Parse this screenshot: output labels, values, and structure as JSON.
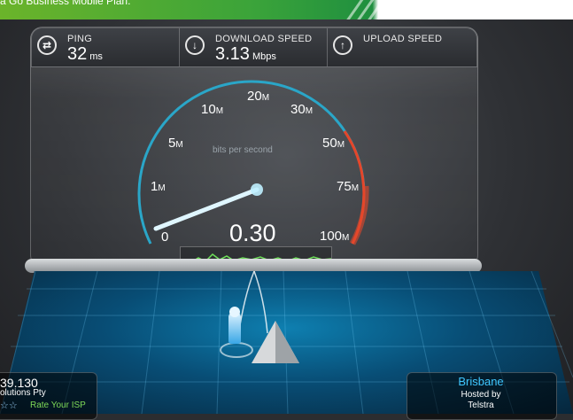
{
  "banner": {
    "text": "a Go Business Mobile Plan."
  },
  "stats": {
    "ping": {
      "label": "PING",
      "value": "32",
      "unit": "ms",
      "icon": "swap-arrows-icon"
    },
    "download": {
      "label": "DOWNLOAD SPEED",
      "value": "3.13",
      "unit": "Mbps",
      "icon": "down-arrow-icon"
    },
    "upload": {
      "label": "UPLOAD SPEED",
      "value": "",
      "unit": "",
      "icon": "up-arrow-icon"
    }
  },
  "gauge": {
    "unit_text": "bits per second",
    "reading": "0.30",
    "labels": [
      {
        "num": "0",
        "suffix": ""
      },
      {
        "num": "1",
        "suffix": "M"
      },
      {
        "num": "5",
        "suffix": "M"
      },
      {
        "num": "10",
        "suffix": "M"
      },
      {
        "num": "20",
        "suffix": "M"
      },
      {
        "num": "30",
        "suffix": "M"
      },
      {
        "num": "50",
        "suffix": "M"
      },
      {
        "num": "75",
        "suffix": "M"
      },
      {
        "num": "100",
        "suffix": "M"
      }
    ],
    "colors": {
      "blue": "#2aa6c8",
      "red": "#e5462a",
      "needle": "#dff6ff"
    }
  },
  "isp": {
    "ip": "39.130",
    "name": "olutions Pty",
    "rate_label": "Rate Your ISP"
  },
  "host": {
    "city": "Brisbane",
    "hosted_by": "Hosted by",
    "name": "Telstra"
  }
}
